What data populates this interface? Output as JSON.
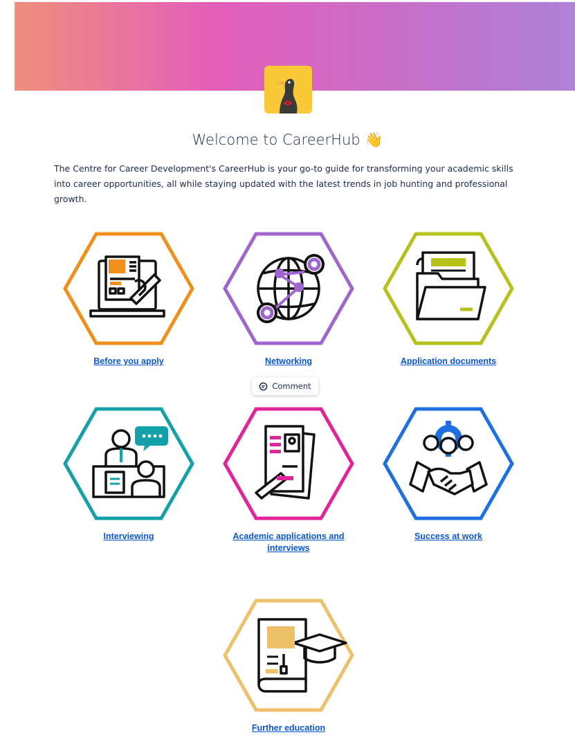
{
  "header": {
    "title": "Welcome to CareerHub",
    "title_emoji": "👋",
    "intro": "The Centre for Career Development's CareerHub is your go-to guide for transforming your academic skills into career opportunities, all while staying updated with the latest trends in job hunting and professional growth."
  },
  "comment_popup": {
    "label": "Comment",
    "icon": "comment-icon"
  },
  "cards": [
    {
      "label": "Before you apply",
      "icon": "laptop-resume-icon",
      "color": "#f0901a"
    },
    {
      "label": "Networking",
      "icon": "globe-network-icon",
      "color": "#a066cf"
    },
    {
      "label": "Application documents",
      "icon": "folder-documents-icon",
      "color": "#b6c21a"
    },
    {
      "label": "Interviewing",
      "icon": "interview-icon",
      "color": "#14a0a8"
    },
    {
      "label": "Academic applications and interviews",
      "icon": "academic-cv-icon",
      "color": "#e0259a"
    },
    {
      "label": "Success at work",
      "icon": "team-handshake-icon",
      "color": "#1e6fe0"
    },
    {
      "label": "Further education",
      "icon": "book-graduation-icon",
      "color": "#eec06a"
    }
  ],
  "colors": {
    "link": "#0b57d0",
    "text": "#172b4d"
  }
}
